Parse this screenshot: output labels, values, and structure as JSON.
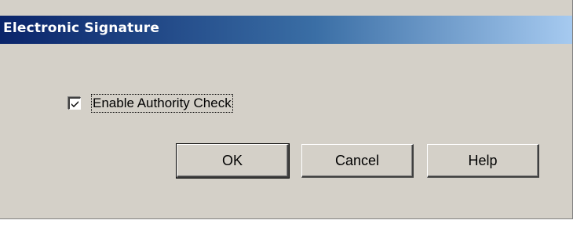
{
  "dialog": {
    "title": "Electronic Signature",
    "checkbox": {
      "label": "Enable Authority Check",
      "checked": true
    },
    "buttons": {
      "ok": "OK",
      "cancel": "Cancel",
      "help": "Help"
    }
  }
}
